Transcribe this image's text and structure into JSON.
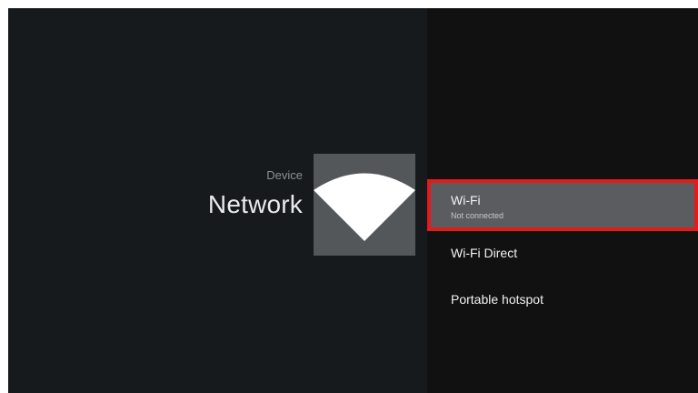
{
  "header": {
    "breadcrumb": "Device",
    "title": "Network"
  },
  "icon": {
    "name": "wifi-icon",
    "tile_color": "#54575a",
    "glyph_color": "#ffffff"
  },
  "menu": {
    "items": [
      {
        "title": "Wi-Fi",
        "subtitle": "Not connected",
        "selected": true
      },
      {
        "title": "Wi-Fi Direct",
        "subtitle": "",
        "selected": false
      },
      {
        "title": "Portable hotspot",
        "subtitle": "",
        "selected": false
      }
    ]
  },
  "colors": {
    "background": "#171a1d",
    "panel": "#111111",
    "selected_item": "#5a5c5f",
    "focus_outline": "#e21b1b"
  }
}
